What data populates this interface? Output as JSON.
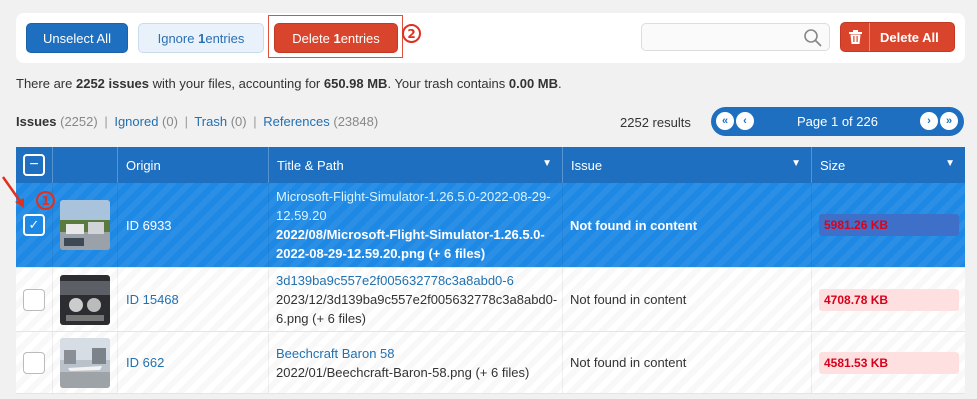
{
  "toolbar": {
    "unselect_all": "Unselect All",
    "ignore_prefix": "Ignore ",
    "ignore_count": "1",
    "ignore_suffix": " entries",
    "delete_prefix": "Delete ",
    "delete_count": "1",
    "delete_suffix": " entries",
    "delete_all": "Delete All",
    "search_placeholder": ""
  },
  "markers": {
    "one": "1",
    "two": "2"
  },
  "summary": {
    "p1": "There are ",
    "issues": "2252 issues",
    "p2": " with your files, accounting for ",
    "size": "650.98 MB",
    "p3": ". Your trash contains ",
    "trash": "0.00 MB",
    "p4": "."
  },
  "filters": {
    "issues_label": "Issues",
    "issues_count": "(2252)",
    "ignored_label": "Ignored",
    "ignored_count": "(0)",
    "trash_label": "Trash",
    "trash_count": "(0)",
    "references_label": "References",
    "references_count": "(23848)",
    "separator": "|"
  },
  "results": "2252 results",
  "pager": {
    "label": "Page 1 of 226",
    "first": "«",
    "prev": "‹",
    "next": "›",
    "last": "»"
  },
  "columns": [
    "Origin",
    "Title & Path",
    "Issue",
    "Size"
  ],
  "rows": [
    {
      "origin": "ID 6933",
      "title": "Microsoft-Flight-Simulator-1.26.5.0-2022-08-29-12.59.20",
      "path": "2022/08/Microsoft-Flight-Simulator-1.26.5.0-2022-08-29-12.59.20.png (+ 6 files)",
      "issue": "Not found in content",
      "size": "5981.26 KB",
      "selected": true
    },
    {
      "origin": "ID 15468",
      "title": "3d139ba9c557e2f005632778c3a8abd0-6",
      "path": "2023/12/3d139ba9c557e2f005632778c3a8abd0-6.png (+ 6 files)",
      "issue": "Not found in content",
      "size": "4708.78 KB",
      "selected": false
    },
    {
      "origin": "ID 662",
      "title": "Beechcraft Baron 58",
      "path": "2022/01/Beechcraft-Baron-58.png (+ 6 files)",
      "issue": "Not found in content",
      "size": "4581.53 KB",
      "selected": false
    }
  ],
  "colors": {
    "primary": "#1e6fbf",
    "danger": "#d9452c",
    "selected_row": "#1e88e5",
    "size_bg": "#ffe0e0",
    "size_text": "#d9001b"
  }
}
